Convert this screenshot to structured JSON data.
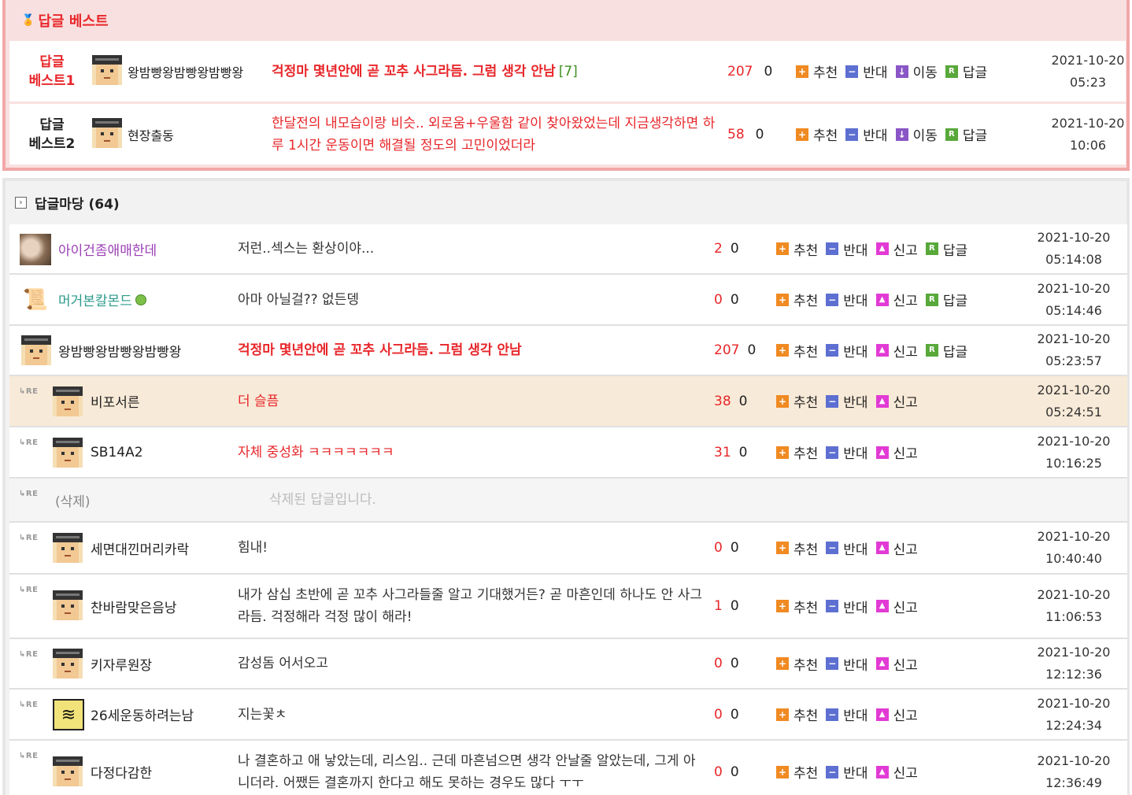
{
  "best": {
    "title": "답글 베스트",
    "rows": [
      {
        "rank": "답글 베스트1",
        "rank_line1": "답글",
        "rank_line2": "베스트1",
        "nick": "왕밤빵왕밤빵왕밤빵왕",
        "content": "걱정마 몇년안에 곧 꼬추 사그라듬. 그럼 생각 안남",
        "comment_count": "[7]",
        "up": "207",
        "down": "0",
        "date": "2021-10-20",
        "time": "05:23"
      },
      {
        "rank": "답글 베스트2",
        "rank_line1": "답글",
        "rank_line2": "베스트2",
        "nick": "현장출동",
        "content": "한달전의 내모습이랑 비슷.. 외로움+우울함 같이 찾아왔었는데 지금생각하면 하루 1시간 운동이면 해결될 정도의 고민이었더라",
        "up": "58",
        "down": "0",
        "date": "2021-10-20",
        "time": "10:06"
      }
    ]
  },
  "actions": {
    "recommend": "추천",
    "oppose": "반대",
    "move": "이동",
    "reply": "답글",
    "report": "신고"
  },
  "area": {
    "title": "답글마당 (64)",
    "re_label": "RE",
    "rows": [
      {
        "nick": "아이건좀애매한데",
        "content": "저런..섹스는 환상이야...",
        "up": "2",
        "down": "0",
        "date": "2021-10-20",
        "time": "05:14:08"
      },
      {
        "nick": "머거본칼몬드",
        "content": "아마 아닐걸?? 없든뎅",
        "up": "0",
        "down": "0",
        "date": "2021-10-20",
        "time": "05:14:46"
      },
      {
        "nick": "왕밤빵왕밤빵왕밤빵왕",
        "content": "걱정마 몇년안에 곧 꼬추 사그라듬. 그럼 생각 안남",
        "up": "207",
        "down": "0",
        "date": "2021-10-20",
        "time": "05:23:57"
      },
      {
        "nick": "비포서른",
        "content": "더 슬픔",
        "up": "38",
        "down": "0",
        "date": "2021-10-20",
        "time": "05:24:51"
      },
      {
        "nick": "SB14A2",
        "content": "자체 중성화 ㅋㅋㅋㅋㅋㅋㅋ",
        "up": "31",
        "down": "0",
        "date": "2021-10-20",
        "time": "10:16:25"
      },
      {
        "nick": "(삭제)",
        "content": "삭제된 답글입니다."
      },
      {
        "nick": "세면대낀머리카락",
        "content": "힘내!",
        "up": "0",
        "down": "0",
        "date": "2021-10-20",
        "time": "10:40:40"
      },
      {
        "nick": "찬바람맞은음낭",
        "content": "내가 삼십 초반에 곧 꼬추 사그라들줄 알고 기대했거든? 곧 마흔인데 하나도 안 사그라듬. 걱정해라 걱정 많이 해라!",
        "up": "1",
        "down": "0",
        "date": "2021-10-20",
        "time": "11:06:53"
      },
      {
        "nick": "키자루원장",
        "content": "감성돔 어서오고",
        "up": "0",
        "down": "0",
        "date": "2021-10-20",
        "time": "12:12:36"
      },
      {
        "nick": "26세운동하려는남",
        "content": "지는꽃ㅊ",
        "up": "0",
        "down": "0",
        "date": "2021-10-20",
        "time": "12:24:34"
      },
      {
        "nick": "다정다감한",
        "content": "나 결혼하고 애 낳았는데, 리스임.. 근데 마흔넘으면 생각 안날줄 알았는데, 그게 아니더라. 어쨌든 결혼까지 한다고 해도 못하는 경우도 많다 ㅜㅜ",
        "up": "0",
        "down": "0",
        "date": "2021-10-20",
        "time": "12:36:49"
      }
    ]
  },
  "colors": {
    "accent_red": "#e8262a",
    "best_bg": "#f9e0e0",
    "best_border": "#f2a7a7",
    "highlight_row": "#f8ead8",
    "reply_green": "#58a83a",
    "nick_purple": "#9b3fb5",
    "nick_teal": "#2a9a8a"
  },
  "icons": {
    "recommend": "plus-icon",
    "oppose": "minus-icon",
    "move": "down-arrow-icon",
    "reply": "reply-r-icon",
    "report": "report-bell-icon",
    "section_toggle": "expand-toggle-icon",
    "best_medal": "medal-icon"
  }
}
